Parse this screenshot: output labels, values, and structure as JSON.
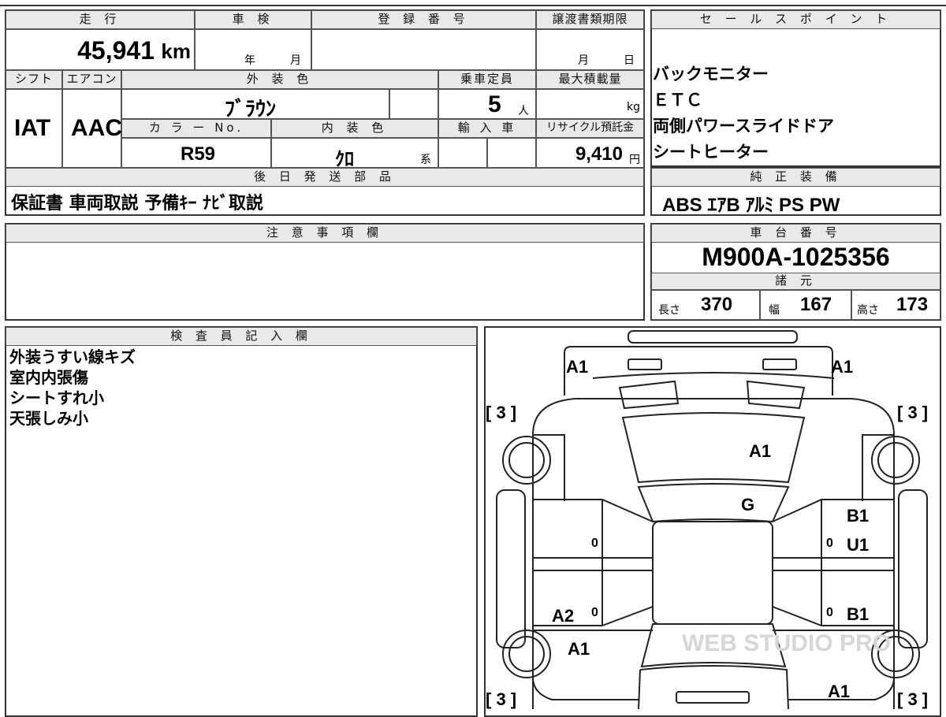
{
  "top_row": {
    "h_mileage": "走 行",
    "h_shaken": "車 検",
    "h_reg": "登 録 番 号",
    "h_transfer": "譲渡書類期限",
    "mileage": "45,941",
    "mileage_unit": "km",
    "shaken_year": "年",
    "shaken_month": "月",
    "transfer_month": "月",
    "transfer_day": "日"
  },
  "spec_row": {
    "h_shift": "シフト",
    "h_ac": "エアコン",
    "h_color": "外 装 色",
    "h_capacity": "乗車定員",
    "h_load": "最大積載量",
    "shift": "IAT",
    "ac": "AAC",
    "color": "ﾌﾞﾗｳﾝ",
    "capacity": "5",
    "capacity_unit": "人",
    "load_unit": "kg",
    "h_color_no": "カ ラ ー No.",
    "h_interior": "内 装 色",
    "h_import": "輸 入 車",
    "h_recycle": "リサイクル預託金",
    "color_no": "R59",
    "interior": "ｸﾛ",
    "interior_suffix": "系",
    "recycle": "9,410",
    "recycle_unit": "円"
  },
  "later_parts": {
    "header": "後 日 発 送 部 品",
    "value": "保証書 車両取説 予備ｷｰ ﾅﾋﾞ取説"
  },
  "sales_points": {
    "header": "セ ー ル ス ポ イ ン ト",
    "items": [
      "バックモニター",
      "ＥＴＣ",
      "両側パワースライドドア",
      "シートヒーター"
    ]
  },
  "equipment": {
    "header": "純 正 装 備",
    "value": "ABS ｴｱB ｱﾙﾐ PS PW"
  },
  "notes": {
    "header": "注 意 事 項 欄",
    "value": ""
  },
  "chassis": {
    "header": "車 台 番 号",
    "value": "M900A-1025356"
  },
  "dimensions": {
    "header": "諸 元",
    "length_label": "長さ",
    "length": "370",
    "width_label": "幅",
    "width": "167",
    "height_label": "高さ",
    "height": "173"
  },
  "inspector": {
    "header": "検 査 員 記 入 欄",
    "lines": [
      "外装うすい線キズ",
      "室内内張傷",
      "シートすれ小",
      "天張しみ小"
    ]
  },
  "diagram": {
    "marks": {
      "a1_tl": "A1",
      "a1_tr": "A1",
      "a1_hood": "A1",
      "g_windshield": "G",
      "b1_rf": "B1",
      "u1_rf": "U1",
      "b1_rr": "B1",
      "a2_lr": "A2",
      "a1_lr": "A1",
      "a1_br": "A1",
      "tire_fl": "[ 3 ]",
      "tire_fr": "[ 3 ]",
      "tire_rl": "[ 3 ]",
      "tire_rr": "[ 3 ]",
      "z1": "0",
      "z2": "0",
      "z3": "0",
      "z4": "0"
    },
    "watermark": "WEB STUDIO PRO"
  }
}
